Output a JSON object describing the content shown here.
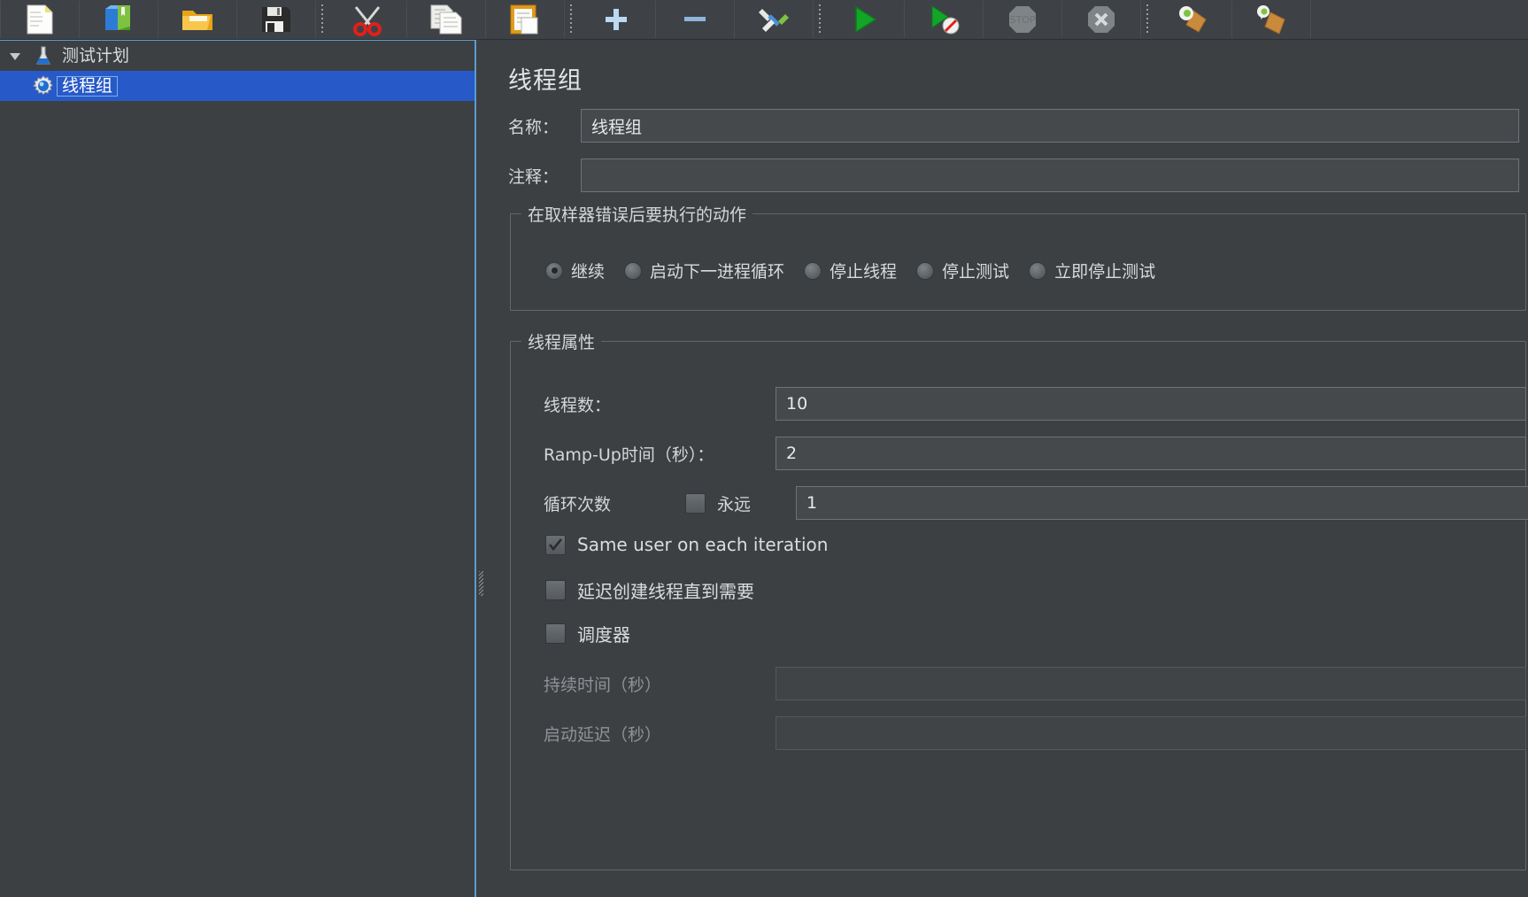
{
  "toolbar": {
    "buttons": [
      {
        "name": "new-test-plan",
        "icon": "new-document-icon",
        "tooltip": "新建"
      },
      {
        "name": "templates",
        "icon": "templates-box-icon",
        "tooltip": "模板"
      },
      {
        "name": "open",
        "icon": "open-folder-icon",
        "tooltip": "打开"
      },
      {
        "name": "save",
        "icon": "save-floppy-icon",
        "tooltip": "保存"
      },
      {
        "name": "separator-1",
        "icon": "separator",
        "tooltip": ""
      },
      {
        "name": "cut",
        "icon": "scissors-icon",
        "tooltip": "剪切"
      },
      {
        "name": "copy",
        "icon": "copy-icon",
        "tooltip": "复制"
      },
      {
        "name": "paste",
        "icon": "paste-icon",
        "tooltip": "粘贴"
      },
      {
        "name": "separator-2",
        "icon": "separator",
        "tooltip": ""
      },
      {
        "name": "expand-all",
        "icon": "plus-icon",
        "tooltip": "展开全部"
      },
      {
        "name": "collapse-all",
        "icon": "minus-icon",
        "tooltip": "折叠全部"
      },
      {
        "name": "toggle",
        "icon": "toggle-pin-icon",
        "tooltip": "切换"
      },
      {
        "name": "separator-3",
        "icon": "separator",
        "tooltip": ""
      },
      {
        "name": "start",
        "icon": "start-play-icon",
        "tooltip": "启动"
      },
      {
        "name": "start-no-pauses",
        "icon": "start-no-pauses-icon",
        "tooltip": "无间隔启动"
      },
      {
        "name": "stop",
        "icon": "stop-octagon-icon",
        "tooltip": "停止"
      },
      {
        "name": "shutdown",
        "icon": "shutdown-x-icon",
        "tooltip": "关闭"
      },
      {
        "name": "separator-4",
        "icon": "separator",
        "tooltip": ""
      },
      {
        "name": "clear",
        "icon": "clear-brush-icon",
        "tooltip": "清除"
      },
      {
        "name": "clear-all",
        "icon": "clear-all-brush-icon",
        "tooltip": "清除全部"
      }
    ]
  },
  "tree": {
    "nodes": [
      {
        "label": "测试计划",
        "icon": "test-plan-flask-icon",
        "expanded": true,
        "selected": false,
        "level": 0
      },
      {
        "label": "线程组",
        "icon": "thread-group-gear-icon",
        "expanded": false,
        "selected": true,
        "level": 1
      }
    ]
  },
  "main": {
    "title": "线程组",
    "name_label": "名称：",
    "name_value": "线程组",
    "comment_label": "注释：",
    "comment_value": "",
    "error_action": {
      "group_title": "在取样器错误后要执行的动作",
      "options": [
        {
          "label": "继续",
          "selected": true
        },
        {
          "label": "启动下一进程循环",
          "selected": false
        },
        {
          "label": "停止线程",
          "selected": false
        },
        {
          "label": "停止测试",
          "selected": false
        },
        {
          "label": "立即停止测试",
          "selected": false
        }
      ]
    },
    "thread_properties": {
      "group_title": "线程属性",
      "threads_label": "线程数：",
      "threads_value": "10",
      "rampup_label": "Ramp-Up时间（秒）：",
      "rampup_value": "2",
      "loops_label": "循环次数",
      "forever_label": "永远",
      "forever_checked": false,
      "loops_value": "1",
      "same_user_label": "Same user on each iteration",
      "same_user_checked": true,
      "delayed_start_label": "延迟创建线程直到需要",
      "delayed_start_checked": false,
      "scheduler_label": "调度器",
      "scheduler_checked": false,
      "duration_label": "持续时间（秒）",
      "duration_value": "",
      "startup_delay_label": "启动延迟（秒）",
      "startup_delay_value": ""
    }
  },
  "colors": {
    "background": "#3c4043",
    "panel": "#3e4246",
    "selection": "#2759c8",
    "accent_border": "#5d9bd1",
    "field_bg": "#46494c",
    "text": "#d6d8da",
    "text_dim": "#8e9296"
  }
}
